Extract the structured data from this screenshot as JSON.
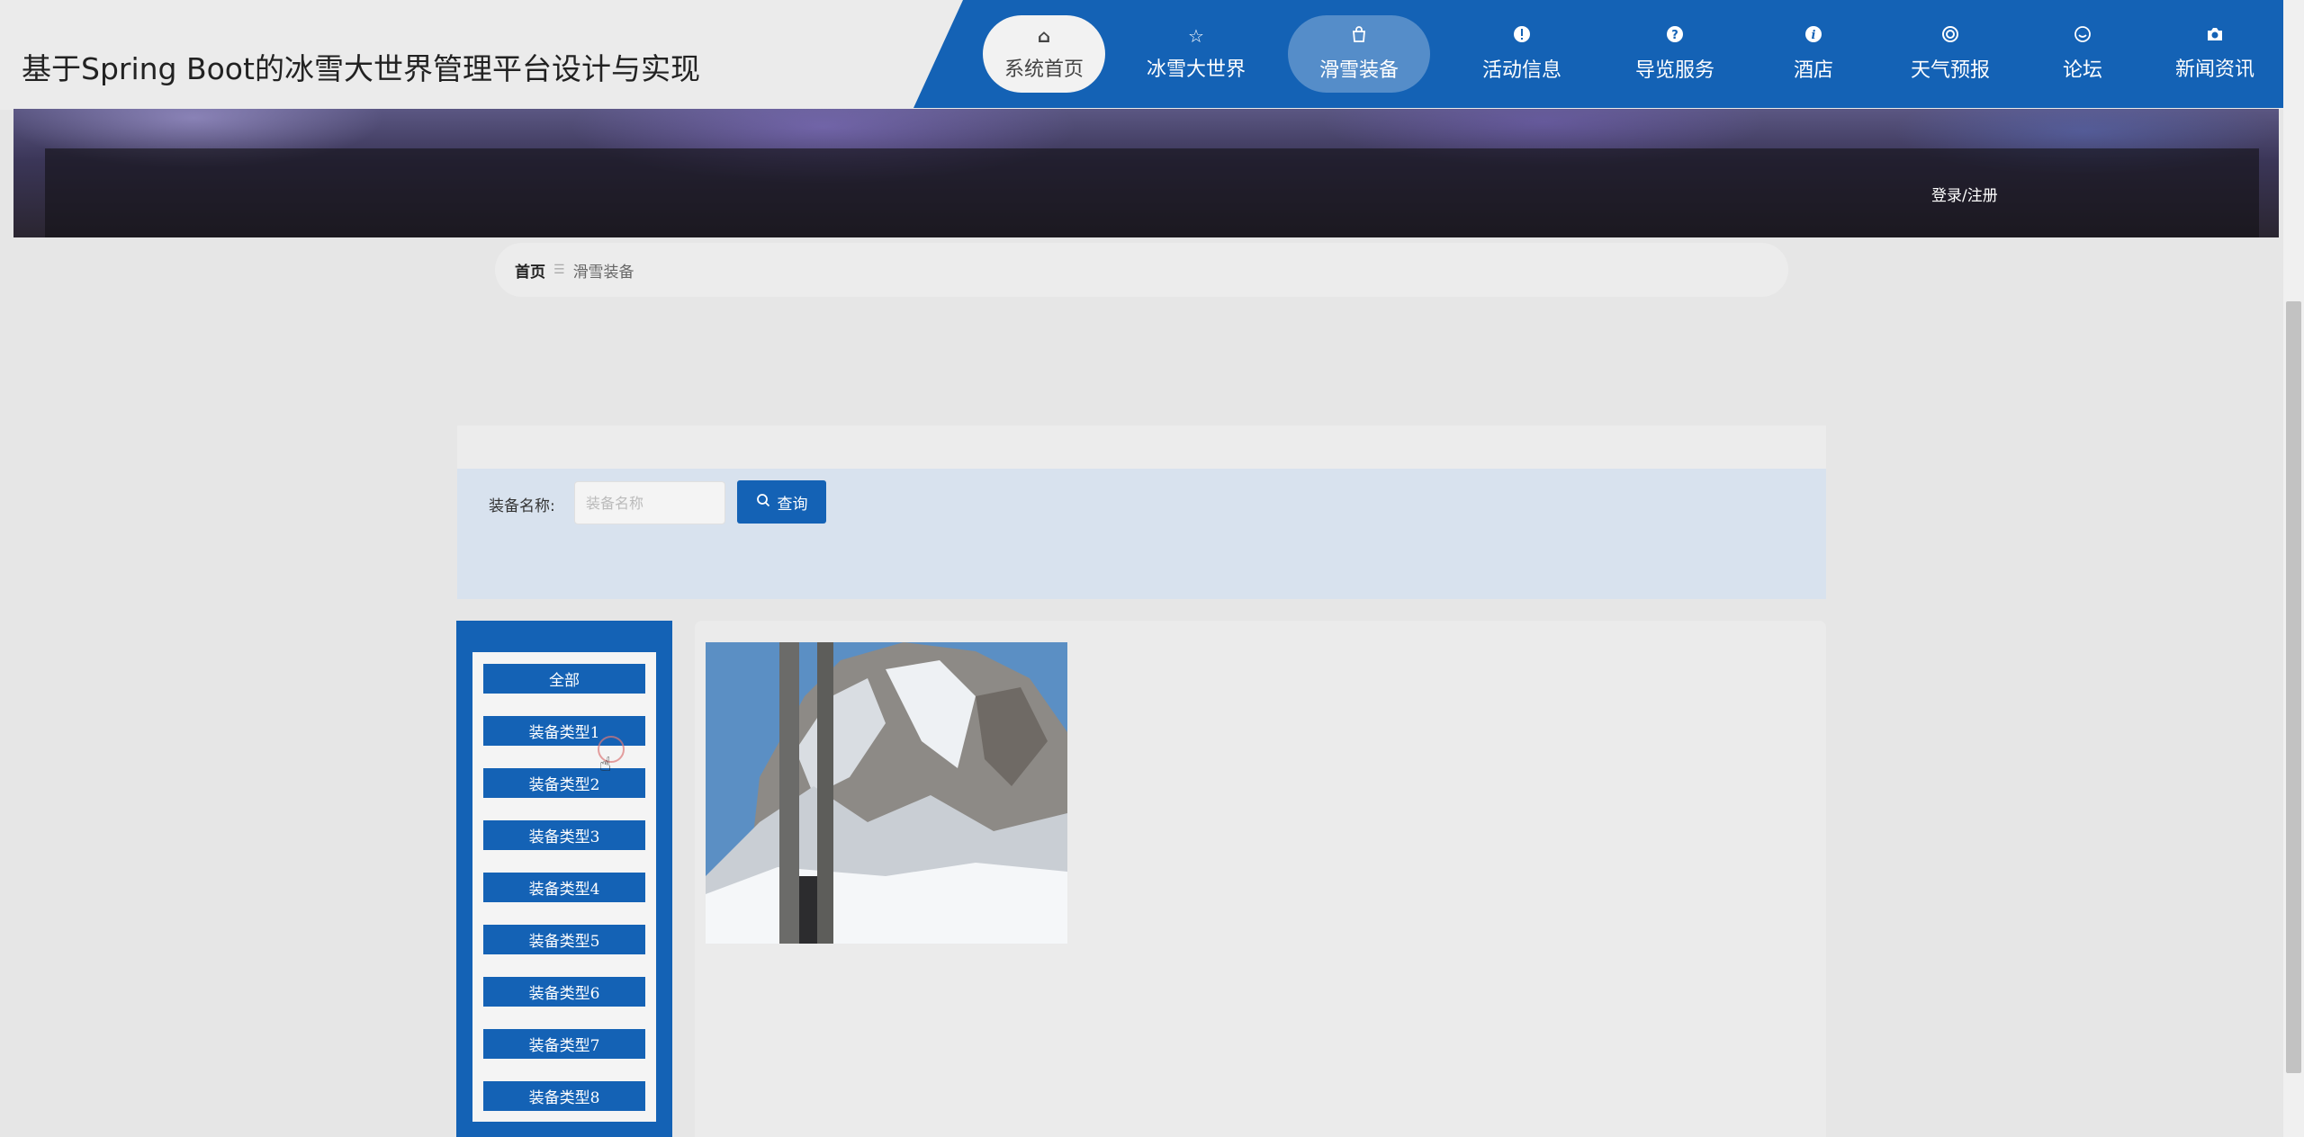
{
  "site": {
    "title": "基于Spring Boot的冰雪大世界管理平台设计与实现"
  },
  "nav": {
    "items": [
      {
        "label": "系统首页",
        "icon": "home-icon"
      },
      {
        "label": "冰雪大世界",
        "icon": "star-icon"
      },
      {
        "label": "滑雪装备",
        "icon": "shopping-bag-icon"
      },
      {
        "label": "活动信息",
        "icon": "exclamation-icon"
      },
      {
        "label": "导览服务",
        "icon": "question-icon"
      },
      {
        "label": "酒店",
        "icon": "info-icon"
      },
      {
        "label": "天气预报",
        "icon": "lifebuoy-icon"
      },
      {
        "label": "论坛",
        "icon": "smile-icon"
      },
      {
        "label": "新闻资讯",
        "icon": "camera-icon"
      }
    ],
    "active": "滑雪装备"
  },
  "banner": {
    "login_label": "登录/注册"
  },
  "breadcrumb": {
    "home": "首页",
    "separator": "☰",
    "current": "滑雪装备"
  },
  "search": {
    "label": "装备名称:",
    "placeholder": "装备名称",
    "value": "",
    "button_label": "查询",
    "button_icon": "search-icon"
  },
  "categories": {
    "items": [
      "全部",
      "装备类型1",
      "装备类型2",
      "装备类型3",
      "装备类型4",
      "装备类型5",
      "装备类型6",
      "装备类型7",
      "装备类型8"
    ]
  },
  "colors": {
    "primary": "#1462b5",
    "search_panel": "#d8e2ee",
    "background": "#e6e6e6"
  }
}
